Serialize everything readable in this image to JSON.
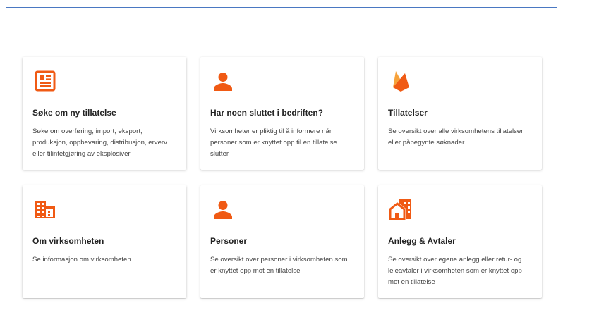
{
  "accent_color": "#f05a14",
  "cards": [
    {
      "icon": "newspaper-icon",
      "title": "Søke om ny tillatelse",
      "description": "Søke om overføring, import, eksport, produksjon, oppbevaring, distribusjon, erverv eller tilintetgjøring av eksplosiver"
    },
    {
      "icon": "person-icon",
      "title": "Har noen sluttet i bedriften?",
      "description": "Virksomheter er pliktig til å informere når personer som er knyttet opp til en tillatelse slutter"
    },
    {
      "icon": "firebase-flame-icon",
      "title": "Tillatelser",
      "description": "Se oversikt over alle virksomhetens tillatelser eller påbegynte søknader"
    },
    {
      "icon": "building-icon",
      "title": "Om virksomheten",
      "description": "Se informasjon om virksomheten"
    },
    {
      "icon": "person-icon",
      "title": "Personer",
      "description": "Se oversikt over personer i virksomheten som er knyttet opp mot en tillatelse"
    },
    {
      "icon": "home-work-icon",
      "title": "Anlegg & Avtaler",
      "description": "Se oversikt over egene anlegg eller retur- og leieavtaler i virksomheten som er knyttet opp mot en tillatelse"
    }
  ]
}
